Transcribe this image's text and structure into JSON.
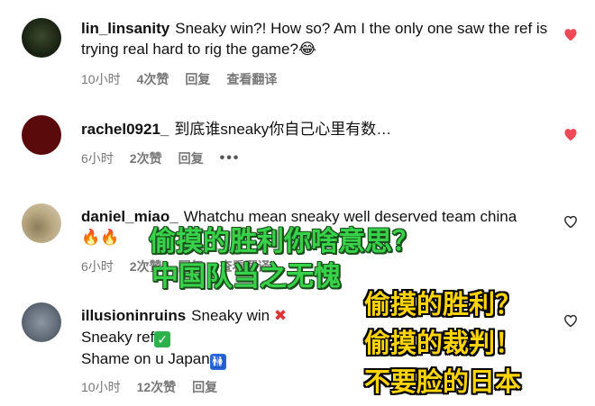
{
  "comments": [
    {
      "username": "lin_linsanity",
      "text": "Sneaky win?! How so? Am I the only one saw the ref is trying real hard to rig the game?",
      "text_emoji": "😂",
      "time": "10小时",
      "likes": "4次赞",
      "reply": "回复",
      "translate": "查看翻译",
      "liked": true
    },
    {
      "username": "rachel0921_",
      "text": "到底谁sneaky你自己心里有数…",
      "time": "6小时",
      "likes": "2次赞",
      "reply": "回复",
      "more": "•••",
      "liked": true
    },
    {
      "username": "daniel_miao_",
      "text": "Whatchu mean sneaky well deserved team china",
      "text_emoji": "🔥🔥",
      "time": "6小时",
      "likes": "2次赞",
      "reply": "回复",
      "translate": "查看翻译",
      "liked": false
    },
    {
      "username": "illusioninruins",
      "line1": "Sneaky win",
      "line1_emoji": "✖",
      "line2": "Sneaky ref",
      "line2_emoji": "✓",
      "line3": "Shame on u Japan",
      "line3_emoji": "🚻",
      "time": "10小时",
      "likes": "12次赞",
      "reply": "回复",
      "liked": false
    }
  ],
  "overlays": {
    "green_line1": "偷摸的胜利你啥意思？",
    "green_line2": "中国队当之无愧",
    "yellow_line1": "偷摸的胜利？",
    "yellow_line2": "偷摸的裁判！",
    "yellow_line3": "不要脸的日本"
  },
  "colors": {
    "heart_liked": "#ed4956",
    "heart_unliked": "#262626",
    "overlay_green": "#38d24a",
    "overlay_yellow": "#ffd400"
  }
}
